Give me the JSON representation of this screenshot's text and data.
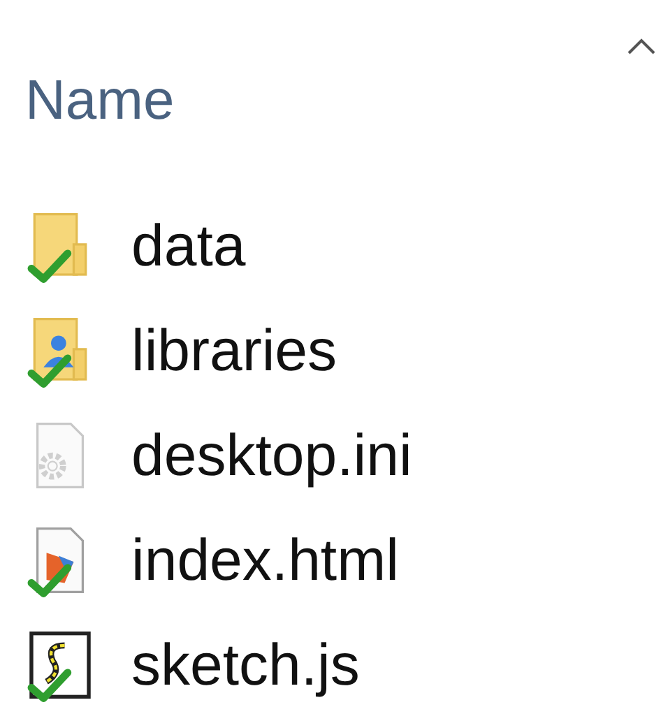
{
  "column_header": {
    "label": "Name",
    "sorted_ascending": true
  },
  "files": [
    {
      "name": "data",
      "kind": "folder",
      "synced": true
    },
    {
      "name": "libraries",
      "kind": "user-folder",
      "synced": true
    },
    {
      "name": "desktop.ini",
      "kind": "settings-file",
      "synced": false
    },
    {
      "name": "index.html",
      "kind": "html-file",
      "synced": true
    },
    {
      "name": "sketch.js",
      "kind": "script-file",
      "synced": true
    }
  ]
}
